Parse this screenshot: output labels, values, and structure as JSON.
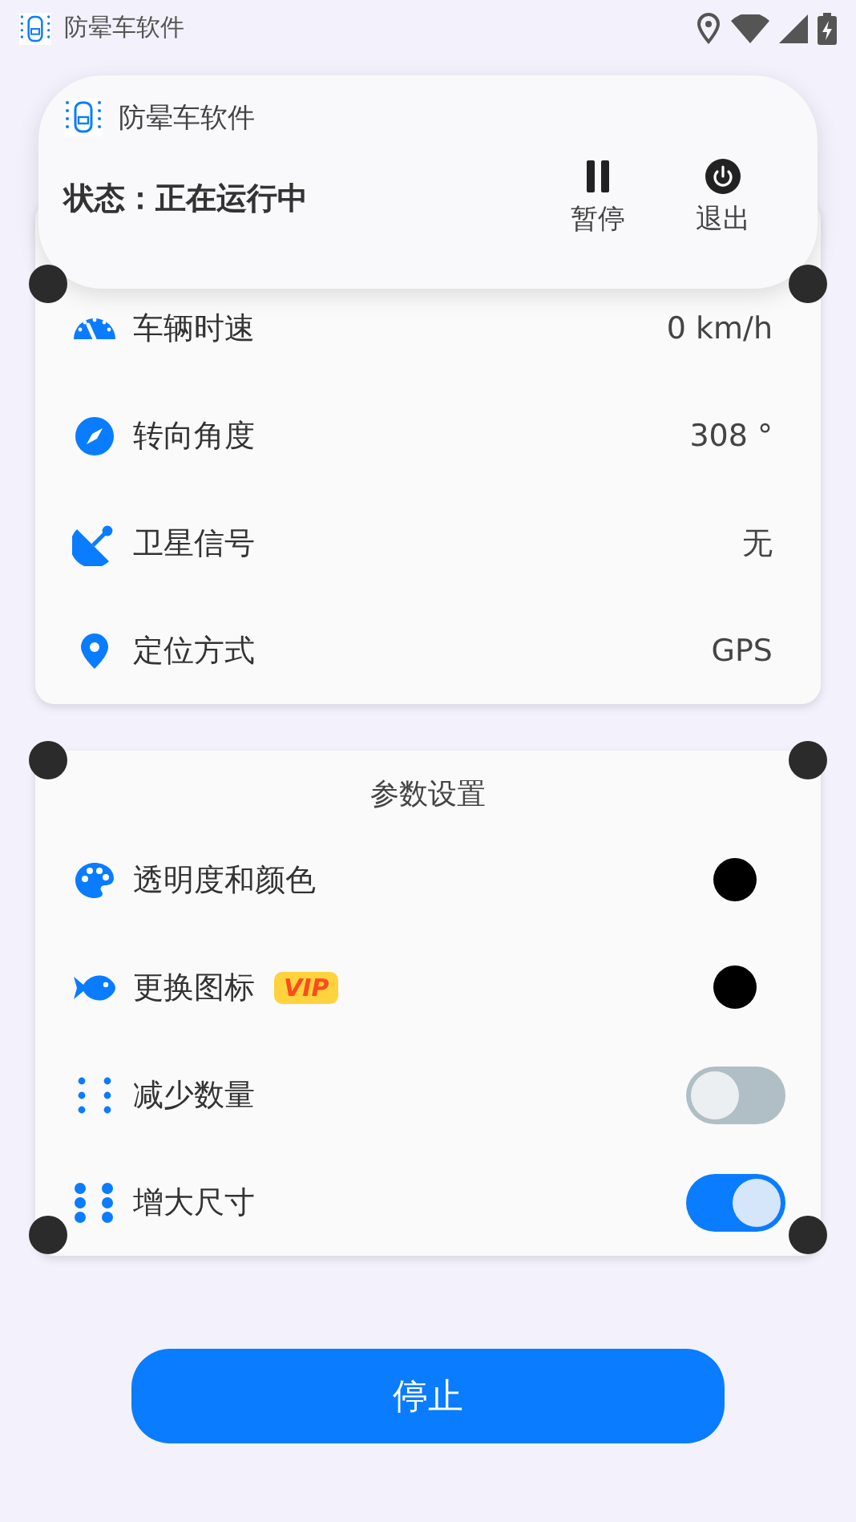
{
  "status_bar": {
    "notification_title": "防晕车软件"
  },
  "popup": {
    "title": "防晕车软件",
    "status": "状态：正在运行中",
    "actions": [
      {
        "kind": "pause",
        "label": "暂停"
      },
      {
        "kind": "exit",
        "label": "退出"
      }
    ]
  },
  "info_rows": [
    {
      "kind": "speed",
      "label": "车辆时速",
      "value": "0 km/h"
    },
    {
      "kind": "heading",
      "label": "转向角度",
      "value": "308 °"
    },
    {
      "kind": "satellite",
      "label": "卫星信号",
      "value": "无"
    },
    {
      "kind": "location",
      "label": "定位方式",
      "value": "GPS"
    }
  ],
  "settings": {
    "title": "参数设置",
    "rows": [
      {
        "kind": "color",
        "label": "透明度和颜色",
        "color": "#000000"
      },
      {
        "kind": "color",
        "label": "更换图标",
        "badge": "VIP",
        "color": "#000000"
      },
      {
        "kind": "toggle",
        "label": "减少数量",
        "on": false
      },
      {
        "kind": "toggle",
        "label": "增大尺寸",
        "on": true
      }
    ]
  },
  "stop_button": "停止"
}
